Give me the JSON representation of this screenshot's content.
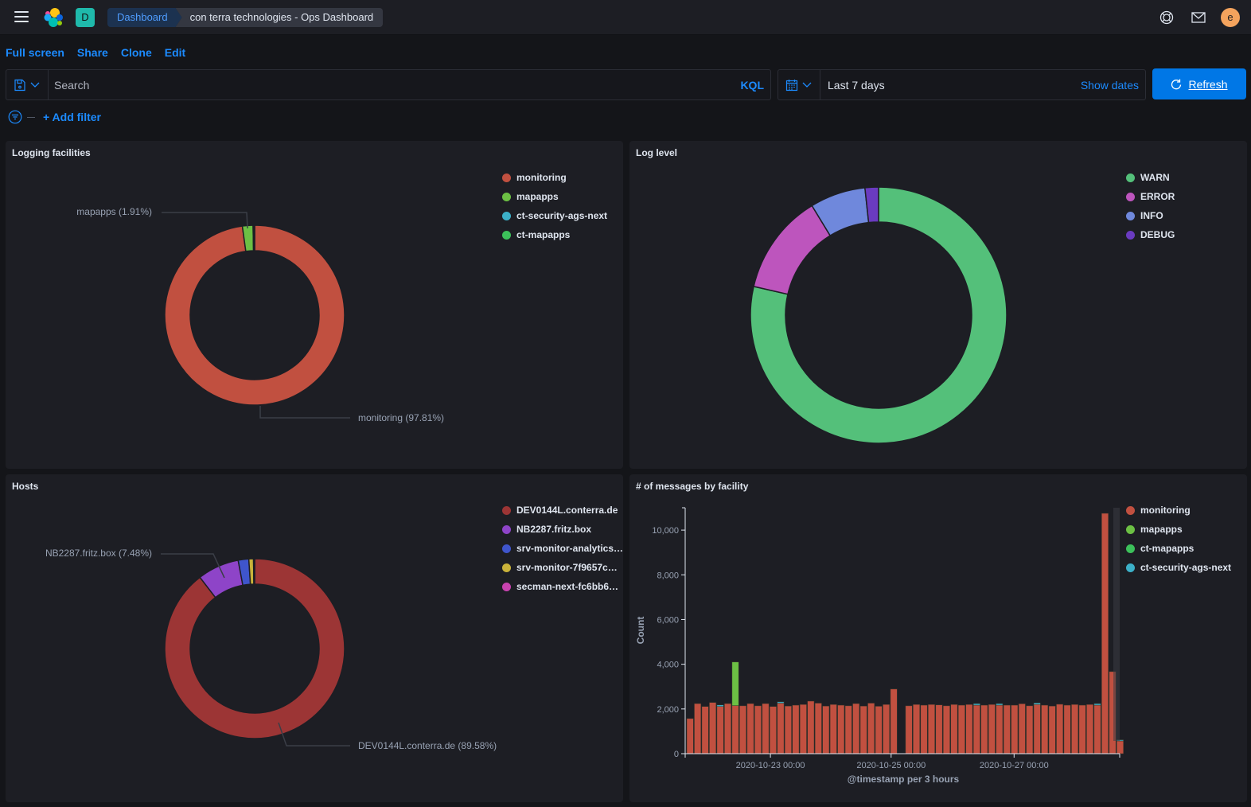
{
  "header": {
    "space_initial": "D",
    "breadcrumbs": [
      "Dashboard",
      "con terra technologies - Ops Dashboard"
    ],
    "avatar_initial": "e",
    "icons": [
      "menu-icon",
      "elastic-logo-icon",
      "help-icon",
      "newsfeed-mail-icon"
    ]
  },
  "topnav": {
    "fullscreen": "Full screen",
    "share": "Share",
    "clone": "Clone",
    "edit": "Edit"
  },
  "query": {
    "placeholder": "Search",
    "language": "KQL"
  },
  "date": {
    "range": "Last 7 days",
    "show_dates": "Show dates",
    "refresh": "Refresh"
  },
  "filters": {
    "add_filter": "+ Add filter"
  },
  "colors": {
    "accent": "#1c8bff",
    "primary_button": "#0077e6",
    "panel_bg": "#1d1e24",
    "page_bg": "#141519"
  },
  "chart_data": [
    {
      "type": "pie",
      "donut": true,
      "title": "Logging facilities",
      "labels": [
        "monitoring",
        "mapapps",
        "ct-security-ags-next",
        "ct-mapapps"
      ],
      "values": [
        97.81,
        1.91,
        0.2,
        0.08
      ],
      "colors": [
        "#c15040",
        "#6cc044",
        "#3cb0c8",
        "#3cc05a"
      ],
      "annotations": [
        "monitoring (97.81%)",
        "mapapps (1.91%)"
      ],
      "legend": "top-right"
    },
    {
      "type": "pie",
      "donut": true,
      "title": "Log level",
      "labels": [
        "WARN",
        "ERROR",
        "INFO",
        "DEBUG"
      ],
      "values": [
        78.6,
        12.7,
        7.0,
        1.7
      ],
      "colors": [
        "#54c07a",
        "#bd55bd",
        "#6f88dc",
        "#6a3bc0"
      ],
      "legend": "top-right"
    },
    {
      "type": "pie",
      "donut": true,
      "title": "Hosts",
      "labels": [
        "DEV0144L.conterra.de",
        "NB2287.fritz.box",
        "srv-monitor-analytics…",
        "srv-monitor-7f9657c…",
        "secman-next-fc6bb6…"
      ],
      "values": [
        89.58,
        7.48,
        1.9,
        0.84,
        0.2
      ],
      "colors": [
        "#9c3535",
        "#8e44c8",
        "#3f55cc",
        "#c9b23a",
        "#c943b0"
      ],
      "annotations": [
        "DEV0144L.conterra.de (89.58%)",
        "NB2287.fritz.box (7.48%)"
      ],
      "legend": "top-right"
    },
    {
      "type": "bar",
      "stacked": true,
      "title": "# of messages by facility",
      "xlabel": "@timestamp per 3 hours",
      "ylabel": "Count",
      "ylim": [
        0,
        11000
      ],
      "yticks": [
        0,
        2000,
        4000,
        6000,
        8000,
        10000
      ],
      "ytick_labels": [
        "0",
        "2,000",
        "4,000",
        "6,000",
        "8,000",
        "10,000"
      ],
      "xtick_labels": [
        "2020-10-23 00:00",
        "2020-10-25 00:00",
        "2020-10-27 00:00"
      ],
      "xtick_bar_index": [
        11.3,
        27.3,
        43.6
      ],
      "legend": "right",
      "series": [
        {
          "name": "monitoring",
          "color": "#c15040",
          "values": [
            1570,
            2240,
            2110,
            2290,
            2110,
            2240,
            2150,
            2140,
            2240,
            2140,
            2240,
            2110,
            2260,
            2130,
            2170,
            2200,
            2350,
            2260,
            2130,
            2200,
            2170,
            2140,
            2240,
            2130,
            2260,
            2120,
            2200,
            2890,
            0,
            2140,
            2200,
            2170,
            2200,
            2180,
            2140,
            2200,
            2170,
            2200,
            2170,
            2170,
            2200,
            2170,
            2170,
            2170,
            2230,
            2140,
            2200,
            2170,
            2130,
            2210,
            2170,
            2200,
            2170,
            2200,
            2170,
            10750,
            3670,
            570
          ]
        },
        {
          "name": "mapapps",
          "color": "#6cc044",
          "values": [
            0,
            0,
            0,
            0,
            0,
            0,
            1950,
            0,
            0,
            0,
            0,
            0,
            0,
            0,
            0,
            0,
            0,
            0,
            0,
            0,
            0,
            0,
            0,
            0,
            0,
            0,
            0,
            0,
            0,
            0,
            0,
            0,
            0,
            0,
            0,
            0,
            0,
            0,
            0,
            0,
            0,
            0,
            0,
            0,
            0,
            0,
            0,
            0,
            0,
            0,
            0,
            0,
            0,
            0,
            0,
            0,
            0,
            0
          ]
        },
        {
          "name": "ct-mapapps",
          "color": "#3cc05a",
          "values": [
            0,
            0,
            0,
            0,
            0,
            0,
            0,
            0,
            0,
            0,
            0,
            0,
            0,
            0,
            0,
            0,
            0,
            0,
            0,
            0,
            0,
            0,
            0,
            0,
            0,
            0,
            0,
            0,
            0,
            0,
            0,
            0,
            0,
            0,
            0,
            0,
            0,
            0,
            0,
            0,
            0,
            0,
            0,
            0,
            0,
            0,
            0,
            0,
            0,
            0,
            0,
            0,
            0,
            0,
            0,
            0,
            0,
            0
          ]
        },
        {
          "name": "ct-security-ags-next",
          "color": "#3cb0c8",
          "values": [
            0,
            0,
            0,
            0,
            70,
            0,
            0,
            0,
            0,
            0,
            0,
            0,
            60,
            0,
            0,
            0,
            0,
            0,
            0,
            0,
            0,
            0,
            0,
            0,
            0,
            0,
            0,
            0,
            0,
            0,
            0,
            0,
            0,
            0,
            0,
            0,
            0,
            0,
            70,
            0,
            0,
            70,
            0,
            0,
            0,
            0,
            70,
            0,
            0,
            0,
            0,
            0,
            0,
            0,
            70,
            0,
            0,
            50
          ]
        }
      ]
    }
  ]
}
